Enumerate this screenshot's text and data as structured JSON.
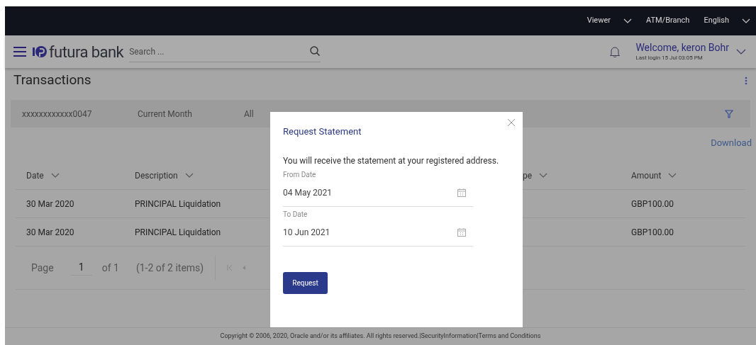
{
  "top_bar": {
    "items": [
      {
        "label": "Viewer",
        "dropdown": true
      },
      {
        "label": "ATM/Branch",
        "dropdown": false
      },
      {
        "label": "English",
        "dropdown": true
      }
    ]
  },
  "header": {
    "logo": "futura bank",
    "search": {
      "placeholder": "Search ..."
    },
    "welcome": "Welcome, keron Bohr",
    "last_login": "Last login 15 Jul 03:05 PM"
  },
  "page_title": "Transactions",
  "filters": [
    "xxxxxxxxxxxx0047",
    "Current Month",
    "All"
  ],
  "download": "Download",
  "table": {
    "columns": [
      {
        "label": "Date"
      },
      {
        "label": "Description"
      },
      {
        "label": "pe"
      },
      {
        "label": "Amount"
      }
    ],
    "rows": [
      {
        "date": "30 Mar 2020",
        "description": "PRINCIPAL Liquidation",
        "amount": "GBP100.00"
      },
      {
        "date": "30 Mar 2020",
        "description": "PRINCIPAL Liquidation",
        "amount": "GBP100.00"
      }
    ]
  },
  "pagination": {
    "page_label": "Page",
    "page": "1",
    "of": "of 1",
    "items": "(1-2 of 2 items)"
  },
  "dialog": {
    "title": "Request Statement",
    "message": "You will receive the statement at your registered address.",
    "fields": [
      {
        "label": "From Date",
        "value": "04 May 2021"
      },
      {
        "label": "To Date",
        "value": "10 Jun 2021"
      }
    ],
    "button": "Request"
  },
  "footer": "Copyright © 2006, 2020, Oracle and/or its affiliates. All rights reserved.|SecurityInformation|Terms and Conditions"
}
